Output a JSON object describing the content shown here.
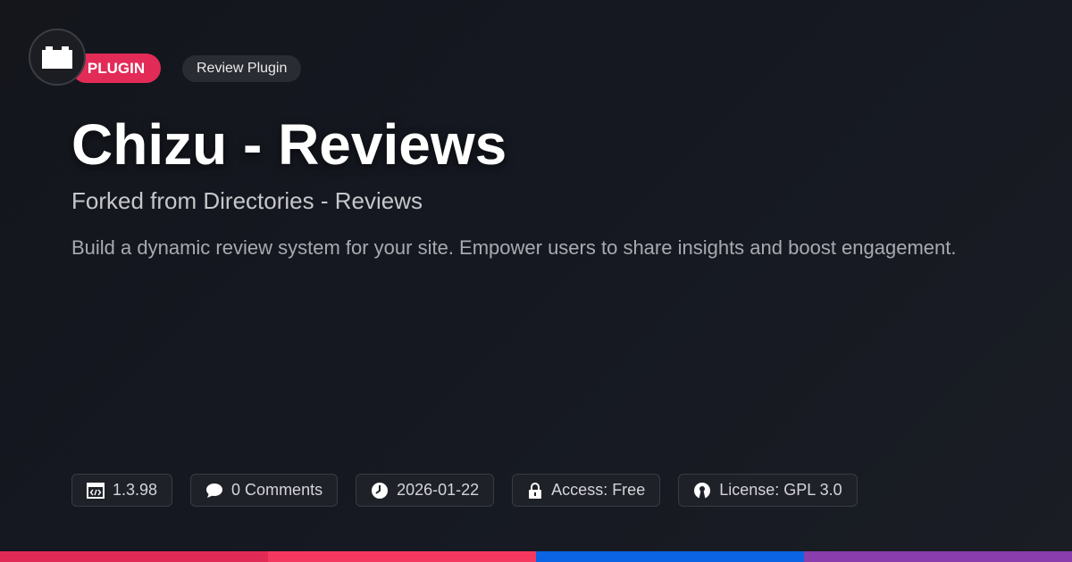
{
  "logo": {
    "icon": "block-icon"
  },
  "badges": {
    "category": "PLUGIN",
    "type": "Review Plugin"
  },
  "title": "Chizu - Reviews",
  "subtitle": "Forked from Directories - Reviews",
  "description": "Build a dynamic review system for your site. Empower users to share insights and boost engagement.",
  "meta": {
    "version": "1.3.98",
    "comments": "0 Comments",
    "date": "2026-01-22",
    "access": "Access: Free",
    "license": "License: GPL 3.0"
  },
  "colors": {
    "accent": "#e32b57",
    "stripes": [
      "#e22a57",
      "#f5385f",
      "#0a64e4",
      "#8a3dad"
    ]
  }
}
